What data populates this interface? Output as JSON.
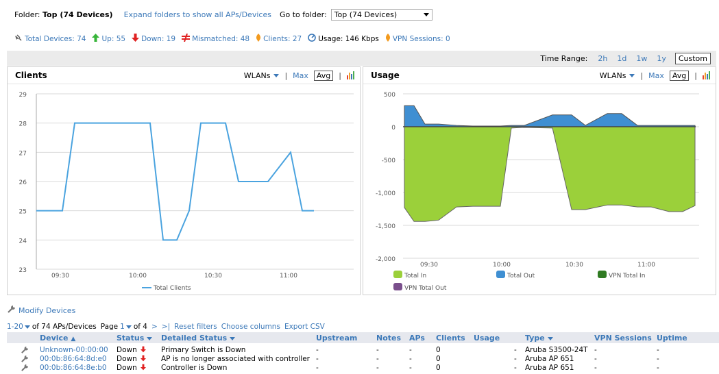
{
  "folder": {
    "label": "Folder:",
    "name": "Top (74 Devices)",
    "expand_link": "Expand folders to show all APs/Devices",
    "goto_label": "Go to folder:",
    "goto_value": "Top (74 Devices)"
  },
  "summary": {
    "total": "Total Devices: 74",
    "up": "Up: 55",
    "down": "Down: 19",
    "mismatched": "Mismatched: 48",
    "clients": "Clients: 27",
    "usage": "Usage: 146 Kbps",
    "vpn": "VPN Sessions: 0"
  },
  "time_range": {
    "label": "Time Range:",
    "options": [
      "2h",
      "1d",
      "1w",
      "1y",
      "Custom"
    ],
    "selected": "Custom"
  },
  "clients_panel": {
    "title": "Clients",
    "wlans": "WLANs",
    "sep": "|",
    "max": "Max",
    "avg": "Avg",
    "selected": "Avg"
  },
  "usage_panel": {
    "title": "Usage",
    "wlans": "WLANs",
    "sep": "|",
    "max": "Max",
    "avg": "Avg",
    "selected": "Avg"
  },
  "chart_data": [
    {
      "type": "line",
      "title": "Clients",
      "ylim": [
        23,
        29
      ],
      "yticks": [
        "23",
        "24",
        "25",
        "26",
        "27",
        "28",
        "29"
      ],
      "xticks": [
        "09:30",
        "10:00",
        "10:30",
        "11:00"
      ],
      "series": [
        {
          "name": "Total Clients",
          "color": "#4aa3df",
          "values": [
            25,
            25,
            28,
            28,
            28,
            28,
            28,
            24,
            24,
            25,
            28,
            28,
            26,
            26,
            26,
            27,
            25,
            25
          ]
        }
      ],
      "grid": true,
      "legend_placement": "bottom"
    },
    {
      "type": "area",
      "title": "Usage",
      "ylim": [
        -2000,
        500
      ],
      "yticks": [
        "-2,000",
        "-1,500",
        "-1,000",
        "-500",
        "0",
        "500"
      ],
      "xticks": [
        "09:30",
        "10:00",
        "10:30",
        "11:00"
      ],
      "series": [
        {
          "name": "Total In",
          "color": "#9bd03a",
          "values": [
            -1230,
            -1440,
            -1440,
            -1420,
            -1220,
            -1210,
            -1210,
            -1210,
            -20,
            -10,
            -20,
            -1260,
            -1260,
            -1190,
            -1190,
            -1220,
            -1220,
            -1290,
            -1290,
            -1200
          ]
        },
        {
          "name": "Total Out",
          "color": "#3f8fd2",
          "values": [
            320,
            320,
            40,
            40,
            20,
            10,
            10,
            10,
            20,
            20,
            180,
            180,
            20,
            200,
            200,
            20,
            20,
            20,
            20,
            20
          ]
        },
        {
          "name": "VPN Total In",
          "color": "#2f7a22",
          "values": []
        },
        {
          "name": "VPN Total Out",
          "color": "#7a4f8c",
          "values": []
        }
      ],
      "grid": true,
      "legend_placement": "bottom"
    }
  ],
  "devices": {
    "modify_label": "Modify Devices",
    "range": "1-20",
    "of_text": "of 74 APs/Devices",
    "page_label": "Page",
    "page": "1",
    "of_pages": "of 4",
    "next": ">",
    "last": ">|",
    "reset": "Reset filters",
    "choose": "Choose columns",
    "export": "Export CSV",
    "columns": [
      "Device",
      "Status",
      "Detailed Status",
      "Upstream",
      "Notes",
      "APs",
      "Clients",
      "Usage",
      "Type",
      "VPN Sessions",
      "Uptime"
    ],
    "rows": [
      {
        "device": "Unknown-00:00:00",
        "status": "Down",
        "detail": "Primary Switch is Down",
        "upstream": "-",
        "notes": "-",
        "aps": "-",
        "clients": "0",
        "usage": "-",
        "type": "Aruba S3500-24T",
        "vpn": "-",
        "uptime": "-"
      },
      {
        "device": "00:0b:86:64:8d:e0",
        "status": "Down",
        "detail": "AP is no longer associated with controller",
        "upstream": "-",
        "notes": "-",
        "aps": "-",
        "clients": "0",
        "usage": "-",
        "type": "Aruba AP 651",
        "vpn": "-",
        "uptime": "-"
      },
      {
        "device": "00:0b:86:64:8e:b0",
        "status": "Down",
        "detail": "Controller is Down",
        "upstream": "-",
        "notes": "-",
        "aps": "-",
        "clients": "0",
        "usage": "-",
        "type": "Aruba AP 651",
        "vpn": "-",
        "uptime": "-"
      }
    ]
  }
}
